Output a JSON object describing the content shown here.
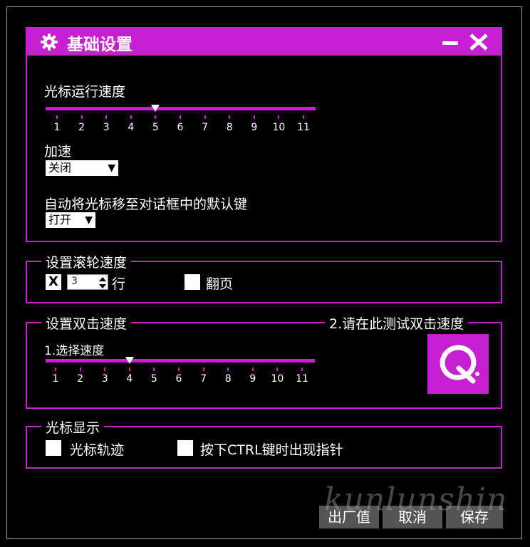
{
  "window": {
    "title": "基础设置",
    "accent_color": "#c81ed2",
    "icons": {
      "settings": "gear-icon",
      "minimize": "minimize-icon",
      "close": "close-icon"
    }
  },
  "pointer": {
    "speed_label": "光标运行速度",
    "speed_ticks": [
      "1",
      "2",
      "3",
      "4",
      "5",
      "6",
      "7",
      "8",
      "9",
      "10",
      "11"
    ],
    "speed_value": 5,
    "accel_label": "加速",
    "accel_value": "关闭",
    "snap_label": "自动将光标移至对话框中的默认键",
    "snap_value": "打开"
  },
  "wheel": {
    "legend": "设置滚轮速度",
    "lines_checked_mark": "X",
    "lines_value": "3",
    "lines_unit": "行",
    "page_label": "翻页"
  },
  "double_click": {
    "legend": "设置双击速度",
    "test_legend": "2.请在此测试双击速度",
    "choose_label": "1.选择速度",
    "ticks": [
      "1",
      "2",
      "3",
      "4",
      "5",
      "6",
      "7",
      "8",
      "9",
      "10",
      "11"
    ],
    "value": 4,
    "test_icon": "q-logo-icon"
  },
  "cursor_display": {
    "legend": "光标显示",
    "trail_label": "光标轨迹",
    "ctrl_label": "按下CTRL键时出现指针"
  },
  "buttons": {
    "factory": "出厂值",
    "cancel": "取消",
    "save": "保存"
  },
  "watermark": "kunlunshin"
}
